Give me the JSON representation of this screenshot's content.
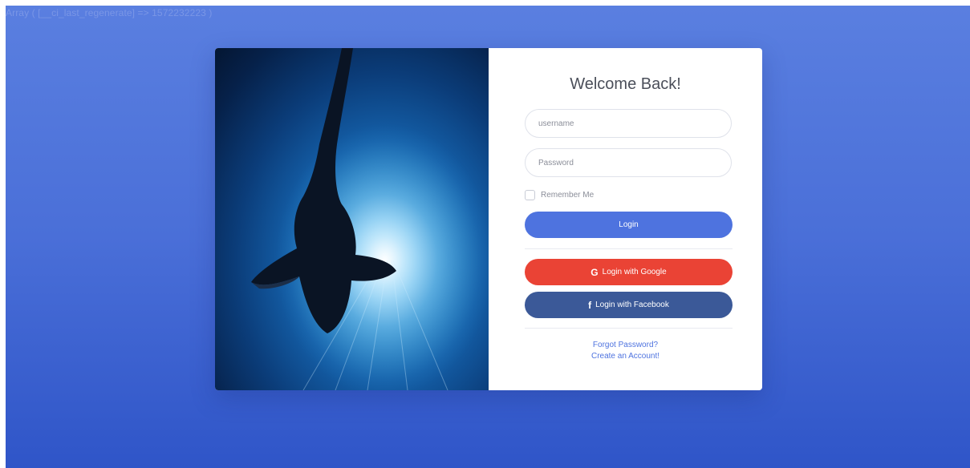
{
  "debug": {
    "text": "Array ( [__ci_last_regenerate] => 1572232223 )"
  },
  "login": {
    "title": "Welcome Back!",
    "username_placeholder": "username",
    "password_placeholder": "Password",
    "remember_label": "Remember Me",
    "login_label": "Login",
    "google_label": "Login with Google",
    "facebook_label": "Login with Facebook",
    "forgot_label": "Forgot Password?",
    "create_label": "Create an Account!"
  },
  "icons": {
    "google": "G",
    "facebook": "f"
  },
  "colors": {
    "background": "#4e73df",
    "primary": "#4e73df",
    "google": "#ea4335",
    "facebook": "#3b5998"
  }
}
